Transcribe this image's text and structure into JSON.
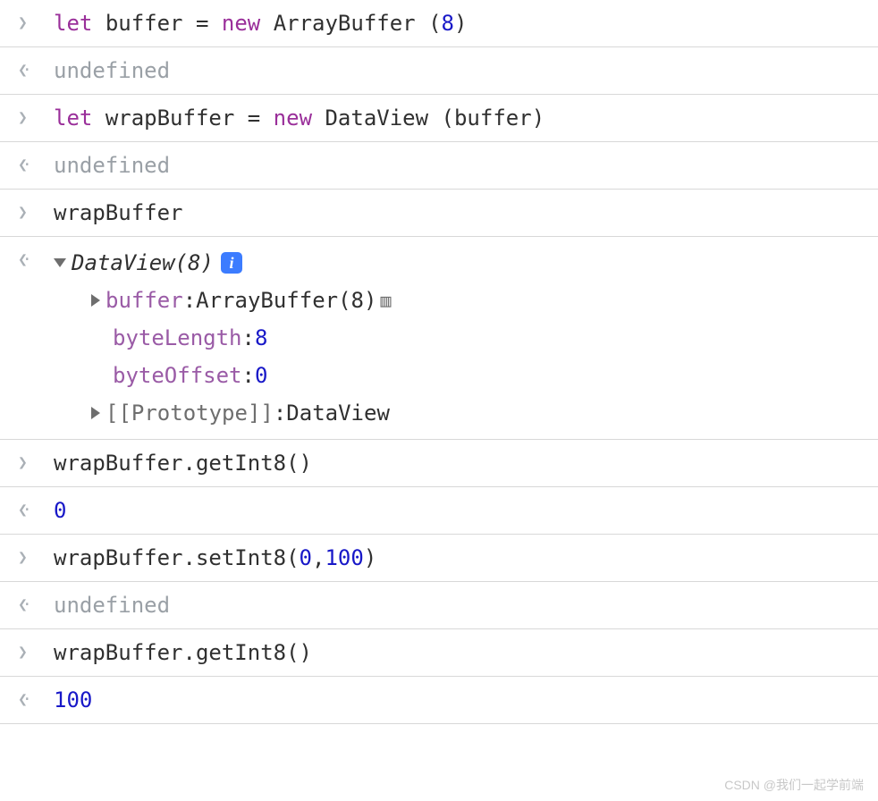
{
  "rows": [
    {
      "type": "input",
      "code": {
        "let": "let",
        "var1": "buffer",
        "eq": " = ",
        "new": "new",
        "ctor": " ArrayBuffer",
        "open": "(",
        "arg": "8",
        "close": ")"
      }
    },
    {
      "type": "output-undef",
      "text": "undefined"
    },
    {
      "type": "input",
      "code": {
        "let": "let",
        "var1": "wrapBuffer",
        "eq": " = ",
        "new": "new",
        "ctor": " DataView",
        "open": "(",
        "argIdent": "buffer",
        "close": ")"
      }
    },
    {
      "type": "output-undef",
      "text": "undefined"
    },
    {
      "type": "input-plain",
      "text": "wrapBuffer"
    },
    {
      "type": "output-tree",
      "head": "DataView(8)",
      "props": [
        {
          "kind": "expandable",
          "name": "buffer",
          "value": "ArrayBuffer(8)",
          "hasMemIcon": true
        },
        {
          "kind": "num",
          "name": "byteLength",
          "value": "8"
        },
        {
          "kind": "num",
          "name": "byteOffset",
          "value": "0"
        },
        {
          "kind": "proto",
          "name": "[[Prototype]]",
          "value": "DataView"
        }
      ]
    },
    {
      "type": "input-plain",
      "text": "wrapBuffer.getInt8()"
    },
    {
      "type": "output-num",
      "text": "0"
    },
    {
      "type": "input-call",
      "obj": "wrapBuffer",
      "method": ".setInt8",
      "open": "(",
      "arg1": "0",
      "comma": ",",
      "arg2": "100",
      "close": ")"
    },
    {
      "type": "output-undef",
      "text": "undefined"
    },
    {
      "type": "input-plain",
      "text": "wrapBuffer.getInt8()"
    },
    {
      "type": "output-num",
      "text": "100"
    }
  ],
  "watermark": "CSDN @我们一起学前端",
  "info_label": "i"
}
